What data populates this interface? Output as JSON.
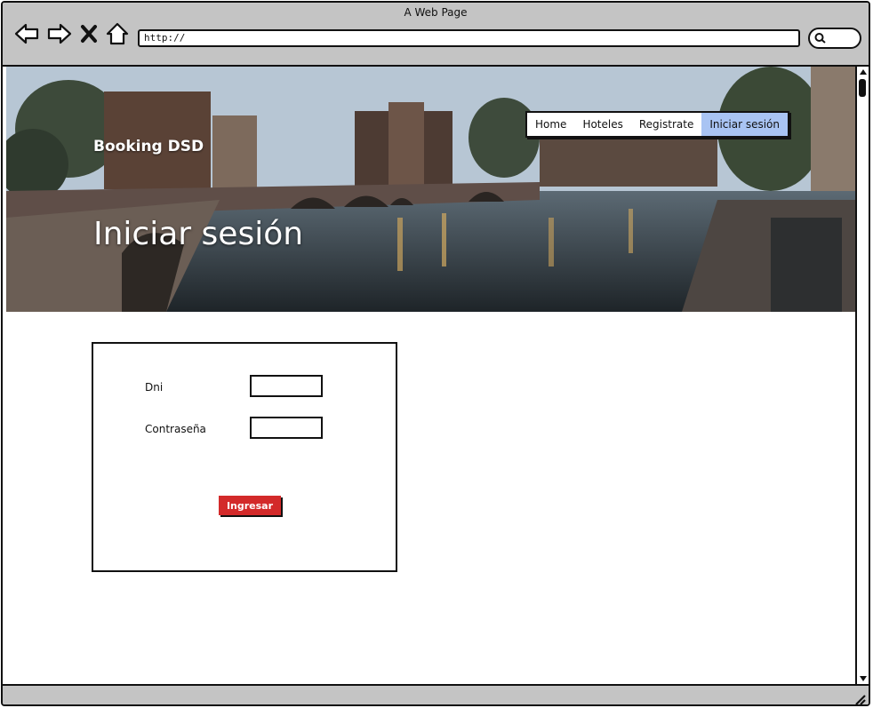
{
  "window": {
    "title": "A Web Page"
  },
  "browser": {
    "url": "http://"
  },
  "hero": {
    "brand": "Booking DSD",
    "title": "Iniciar sesión"
  },
  "nav": {
    "items": [
      {
        "label": "Home"
      },
      {
        "label": "Hoteles"
      },
      {
        "label": "Registrate"
      },
      {
        "label": "Iniciar sesión",
        "active": true
      }
    ]
  },
  "form": {
    "dni_label": "Dni",
    "dni_value": "",
    "password_label": "Contraseña",
    "password_value": "",
    "submit_label": "Ingresar"
  },
  "icons": [
    "back-icon",
    "forward-icon",
    "close-icon",
    "home-icon",
    "search-icon",
    "resize-grip-icon"
  ],
  "colors": {
    "active_tab": "#a9c4f3",
    "submit_button": "#d32a2a",
    "chrome": "#c4c4c4"
  }
}
